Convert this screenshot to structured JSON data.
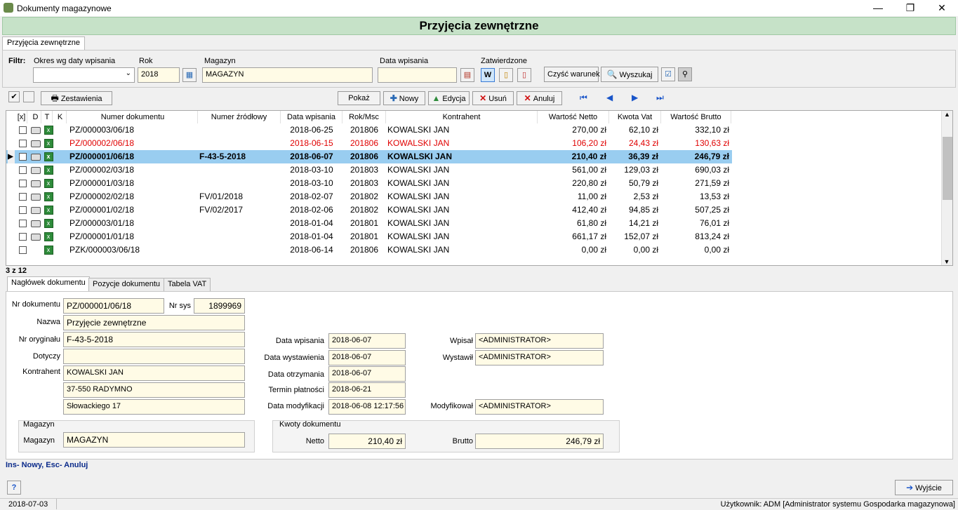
{
  "window": {
    "title": "Dokumenty magazynowe",
    "minimize": "—",
    "restore": "❐",
    "close": "✕"
  },
  "banner": {
    "title": "Przyjęcia zewnętrzne"
  },
  "main_tab": {
    "label": "Przyjęcia zewnętrzne"
  },
  "filter": {
    "label": "Filtr:",
    "okres_label": "Okres wg daty wpisania",
    "okres_value": "",
    "rok_label": "Rok",
    "rok_value": "2018",
    "magazyn_label": "Magazyn",
    "magazyn_value": "MAGAZYN",
    "data_label": "Data wpisania",
    "data_value": "",
    "zatwierdzone_label": "Zatwierdzone",
    "clear_label": "Czyść warunek",
    "search_label": "Wyszukaj"
  },
  "toolbar": {
    "zestawienia": "Zestawienia",
    "pokaz": "Pokaż",
    "nowy": "Nowy",
    "edycja": "Edycja",
    "usun": "Usuń",
    "anuluj": "Anuluj"
  },
  "grid": {
    "headers": [
      "[x]",
      "D",
      "T",
      "K",
      "Numer dokumentu",
      "Numer źródłowy",
      "Data wpisania",
      "Rok/Msc",
      "Kontrahent",
      "Wartość Netto",
      "Kwota Vat",
      "Wartość Brutto"
    ],
    "rows": [
      {
        "num": "PZ/000003/06/18",
        "src": "",
        "date": "2018-06-25",
        "rok": "201806",
        "kontr": "KOWALSKI JAN",
        "netto": "270,00 zł",
        "vat": "62,10 zł",
        "brutto": "332,10 zł",
        "style": ""
      },
      {
        "num": "PZ/000002/06/18",
        "src": "",
        "date": "2018-06-15",
        "rok": "201806",
        "kontr": "KOWALSKI JAN",
        "netto": "106,20 zł",
        "vat": "24,43 zł",
        "brutto": "130,63 zł",
        "style": "red"
      },
      {
        "num": "PZ/000001/06/18",
        "src": "F-43-5-2018",
        "date": "2018-06-07",
        "rok": "201806",
        "kontr": "KOWALSKI JAN",
        "netto": "210,40 zł",
        "vat": "36,39 zł",
        "brutto": "246,79 zł",
        "style": "sel"
      },
      {
        "num": "PZ/000002/03/18",
        "src": "",
        "date": "2018-03-10",
        "rok": "201803",
        "kontr": "KOWALSKI JAN",
        "netto": "561,00 zł",
        "vat": "129,03 zł",
        "brutto": "690,03 zł",
        "style": ""
      },
      {
        "num": "PZ/000001/03/18",
        "src": "",
        "date": "2018-03-10",
        "rok": "201803",
        "kontr": "KOWALSKI JAN",
        "netto": "220,80 zł",
        "vat": "50,79 zł",
        "brutto": "271,59 zł",
        "style": ""
      },
      {
        "num": "PZ/000002/02/18",
        "src": "FV/01/2018",
        "date": "2018-02-07",
        "rok": "201802",
        "kontr": "KOWALSKI JAN",
        "netto": "11,00 zł",
        "vat": "2,53 zł",
        "brutto": "13,53 zł",
        "style": ""
      },
      {
        "num": "PZ/000001/02/18",
        "src": "FV/02/2017",
        "date": "2018-02-06",
        "rok": "201802",
        "kontr": "KOWALSKI JAN",
        "netto": "412,40 zł",
        "vat": "94,85 zł",
        "brutto": "507,25 zł",
        "style": ""
      },
      {
        "num": "PZ/000003/01/18",
        "src": "",
        "date": "2018-01-04",
        "rok": "201801",
        "kontr": "KOWALSKI JAN",
        "netto": "61,80 zł",
        "vat": "14,21 zł",
        "brutto": "76,01 zł",
        "style": ""
      },
      {
        "num": "PZ/000001/01/18",
        "src": "",
        "date": "2018-01-04",
        "rok": "201801",
        "kontr": "KOWALSKI JAN",
        "netto": "661,17 zł",
        "vat": "152,07 zł",
        "brutto": "813,24 zł",
        "style": ""
      },
      {
        "num": "PZK/000003/06/18",
        "src": "",
        "date": "2018-06-14",
        "rok": "201806",
        "kontr": "KOWALSKI JAN",
        "netto": "0,00 zł",
        "vat": "0,00 zł",
        "brutto": "0,00 zł",
        "style": ""
      }
    ],
    "counter": "3 z 12"
  },
  "detail_tabs": [
    "Nagłówek dokumentu",
    "Pozycje dokumentu",
    "Tabela VAT"
  ],
  "form": {
    "nr_dok_label": "Nr dokumentu",
    "nr_dok": "PZ/000001/06/18",
    "nr_sys_label": "Nr sys",
    "nr_sys": "1899969",
    "nazwa_label": "Nazwa",
    "nazwa": "Przyjęcie zewnętrzne",
    "nr_oryg_label": "Nr oryginału",
    "nr_oryg": "F-43-5-2018",
    "dotyczy_label": "Dotyczy",
    "dotyczy": "",
    "kontrahent_label": "Kontrahent",
    "kontr1": "KOWALSKI JAN",
    "kontr2": "37-550 RADYMNO",
    "kontr3": "Słowackiego 17",
    "data_wpis_label": "Data wpisania",
    "data_wpis": "2018-06-07",
    "data_wyst_label": "Data wystawienia",
    "data_wyst": "2018-06-07",
    "data_otrz_label": "Data otrzymania",
    "data_otrz": "2018-06-07",
    "termin_label": "Termin płatności",
    "termin": "2018-06-21",
    "data_mod_label": "Data modyfikacji",
    "data_mod": "2018-06-08 12:17:56",
    "wpisal_label": "Wpisał",
    "wpisal": "<ADMINISTRATOR>",
    "wystawil_label": "Wystawił",
    "wystawil": "<ADMINISTRATOR>",
    "modyf_label": "Modyfikował",
    "modyf": "<ADMINISTRATOR>",
    "mag_group": "Magazyn",
    "mag_label": "Magazyn",
    "mag": "MAGAZYN",
    "kwoty_group": "Kwoty dokumentu",
    "netto_label": "Netto",
    "netto": "210,40 zł",
    "brutto_label": "Brutto",
    "brutto": "246,79 zł"
  },
  "hint": "Ins- Nowy, Esc- Anuluj",
  "footer": {
    "help": "?",
    "exit": "Wyjście"
  },
  "status": {
    "date": "2018-07-03",
    "user": "Użytkownik: ADM [Administrator systemu Gospodarka magazynowa]"
  }
}
